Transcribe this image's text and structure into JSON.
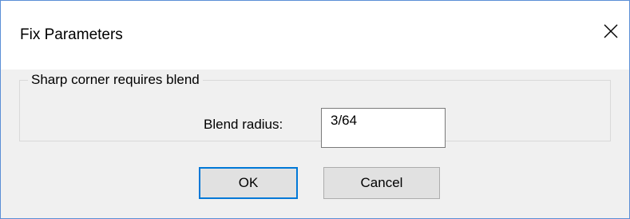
{
  "window": {
    "title": "Fix Parameters",
    "close_icon": "close-icon"
  },
  "group": {
    "label": "Sharp corner requires blend",
    "field_label": "Blend radius:",
    "field_value": "3/64"
  },
  "buttons": {
    "ok_label": "OK",
    "cancel_label": "Cancel"
  },
  "colors": {
    "window_border": "#5b8fd6",
    "dialog_bg": "#f0f0f0",
    "titlebar_bg": "#ffffff",
    "default_button_border": "#0078d7",
    "button_bg": "#e1e1e1"
  }
}
